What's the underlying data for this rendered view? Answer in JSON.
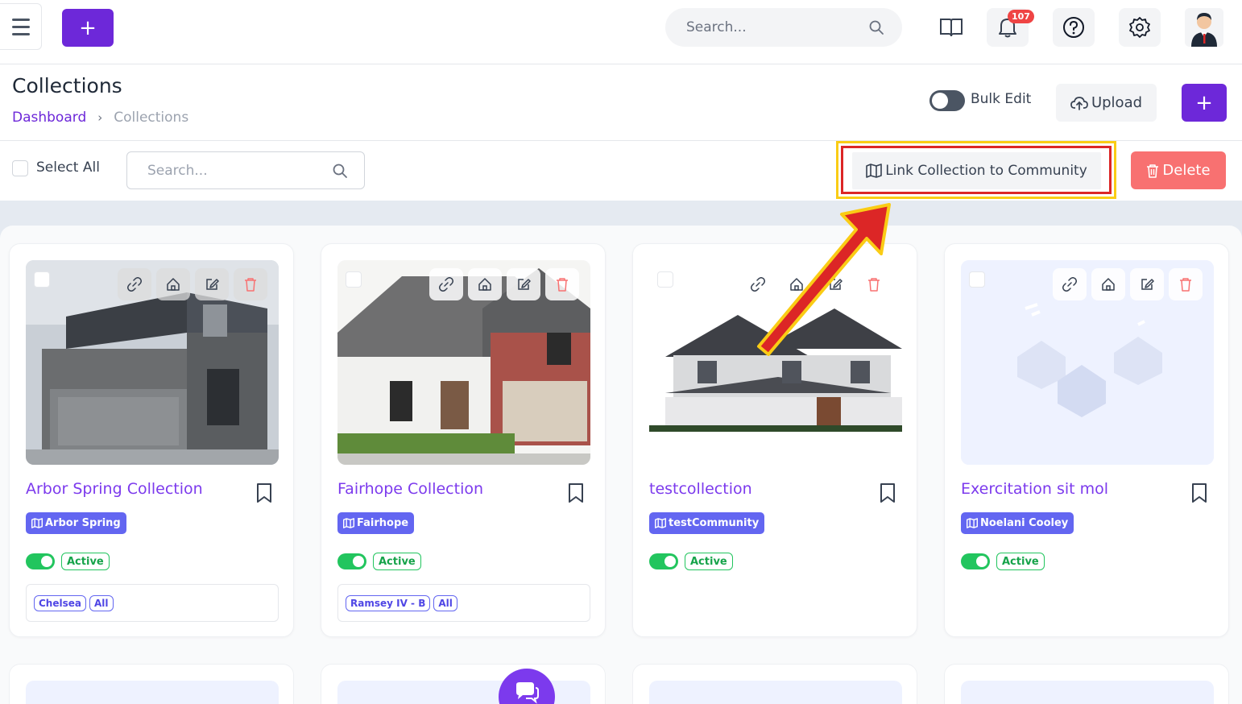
{
  "topbar": {
    "add_label": "+",
    "search_placeholder": "Search...",
    "notification_count": "107",
    "icons": [
      "menu-icon",
      "plus-icon",
      "search-icon",
      "book-icon",
      "bell-icon",
      "help-icon",
      "gear-icon",
      "avatar"
    ]
  },
  "header": {
    "title": "Collections",
    "breadcrumb": {
      "home": "Dashboard",
      "separator": "›",
      "current": "Collections"
    },
    "bulk_edit_label": "Bulk Edit",
    "upload_label": "Upload",
    "add_label": "+"
  },
  "toolbar": {
    "select_all_label": "Select All",
    "search_placeholder": "Search...",
    "link_label": "Link Collection to Community",
    "delete_label": "Delete"
  },
  "cards": [
    {
      "title": "Arbor Spring Collection",
      "community": "Arbor Spring",
      "status": "Active",
      "tags": [
        "Chelsea",
        "All"
      ]
    },
    {
      "title": "Fairhope Collection",
      "community": "Fairhope",
      "status": "Active",
      "tags": [
        "Ramsey IV - B",
        "All"
      ]
    },
    {
      "title": "testcollection",
      "community": "testCommunity",
      "status": "Active",
      "tags": []
    },
    {
      "title": "Exercitation sit mol",
      "community": "Noelani Cooley",
      "status": "Active",
      "tags": []
    }
  ],
  "colors": {
    "primary": "#6d28d9",
    "title": "#7c3aed",
    "tag": "#6366f1",
    "active": "#22c55e",
    "danger": "#f87171",
    "annotation_arrow": "#dc2626",
    "annotation_outline": "#facc15"
  }
}
